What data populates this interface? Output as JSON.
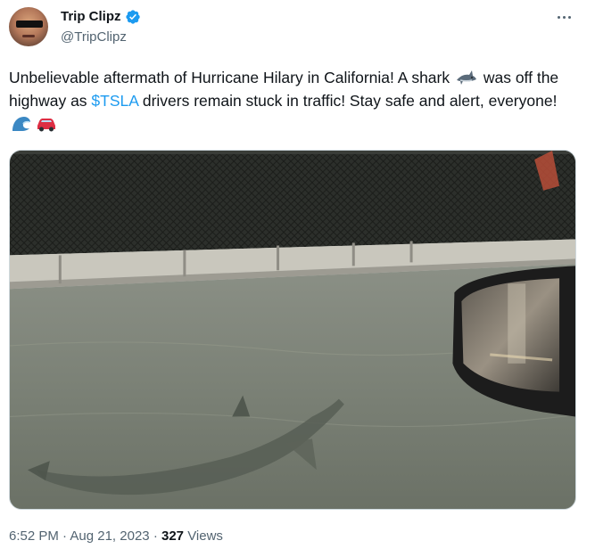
{
  "tweet": {
    "display_name": "Trip Clipz",
    "handle": "@TripClipz",
    "text_part1": "Unbelievable aftermath of Hurricane Hilary in California! A shark ",
    "text_part2": " was off the highway as ",
    "cashtag": "$TSLA",
    "text_part3": " drivers remain stuck in traffic! Stay safe and alert, everyone! ",
    "emoji_shark": "shark-emoji",
    "emoji_wave": "wave-emoji",
    "emoji_car": "car-emoji"
  },
  "meta": {
    "time": "6:52 PM",
    "separator": "·",
    "date": "Aug 21, 2023",
    "views_count": "327",
    "views_label": "Views"
  },
  "icons": {
    "verified": "verified-badge-icon",
    "more": "more-options-icon"
  },
  "colors": {
    "accent": "#1d9bf0",
    "secondary_text": "#536471",
    "primary_text": "#0f1419"
  }
}
